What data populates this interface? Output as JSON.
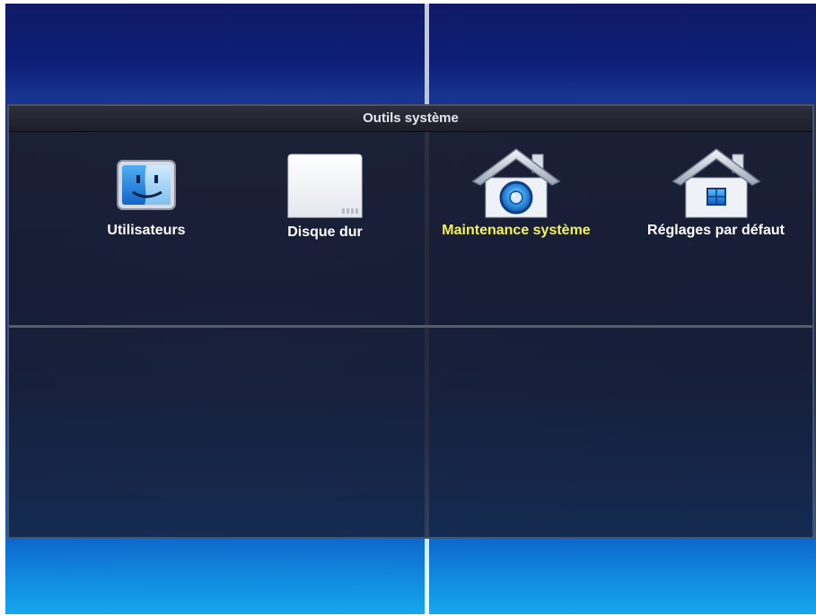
{
  "window": {
    "title": "Outils système"
  },
  "menu": {
    "items": [
      {
        "label": "Utilisateurs",
        "icon": "users-finder-icon",
        "selected": false
      },
      {
        "label": "Disque dur",
        "icon": "hard-disk-icon",
        "selected": false
      },
      {
        "label": "Maintenance système",
        "icon": "house-maintenance-icon",
        "selected": true
      },
      {
        "label": "Réglages par défaut",
        "icon": "house-default-icon",
        "selected": false
      }
    ]
  },
  "colors": {
    "selected_label": "#f5f25a",
    "label": "#ffffff",
    "panel_title": "#e6e8ee"
  }
}
